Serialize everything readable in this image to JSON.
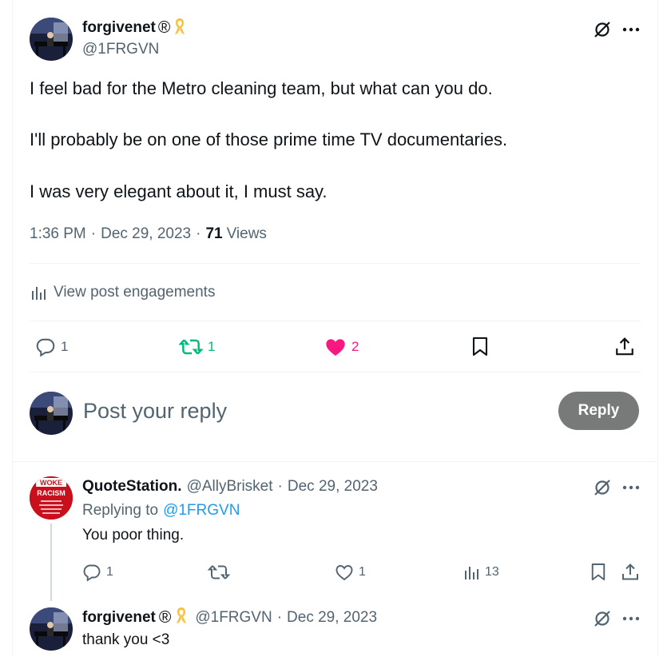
{
  "main_post": {
    "author_name": "forgivenet",
    "registered_mark": "®",
    "handle": "@1FRGVN",
    "paragraphs": [
      "I feel bad for the Metro cleaning team, but what can you do.",
      "I'll probably be on one of those prime time TV documentaries.",
      "I was very elegant about it, I must say."
    ],
    "time": "1:36 PM",
    "separator": "·",
    "date": "Dec 29, 2023",
    "views_count": "71",
    "views_label": "Views",
    "engagements_label": "View post engagements",
    "reply_count": "1",
    "repost_count": "1",
    "like_count": "2"
  },
  "composer": {
    "placeholder": "Post your reply",
    "button_label": "Reply"
  },
  "replies": [
    {
      "author_name": "QuoteStation.",
      "handle": "@AllyBrisket",
      "separator": "·",
      "date": "Dec 29, 2023",
      "replying_to_label": "Replying to",
      "replying_to_handle": "@1FRGVN",
      "text": "You poor thing.",
      "reply_count": "1",
      "like_count": "1",
      "views_count": "13",
      "avatar_text": [
        "WOKE",
        "RACISM"
      ]
    },
    {
      "author_name": "forgivenet",
      "registered_mark": "®",
      "handle": "@1FRGVN",
      "separator": "·",
      "date": "Dec 29, 2023",
      "text": "thank you <3"
    }
  ],
  "colors": {
    "repost_green": "#00ba7c",
    "like_pink": "#f91880",
    "link_blue": "#1d9bf0",
    "ribbon_gold": "#f5c242"
  }
}
